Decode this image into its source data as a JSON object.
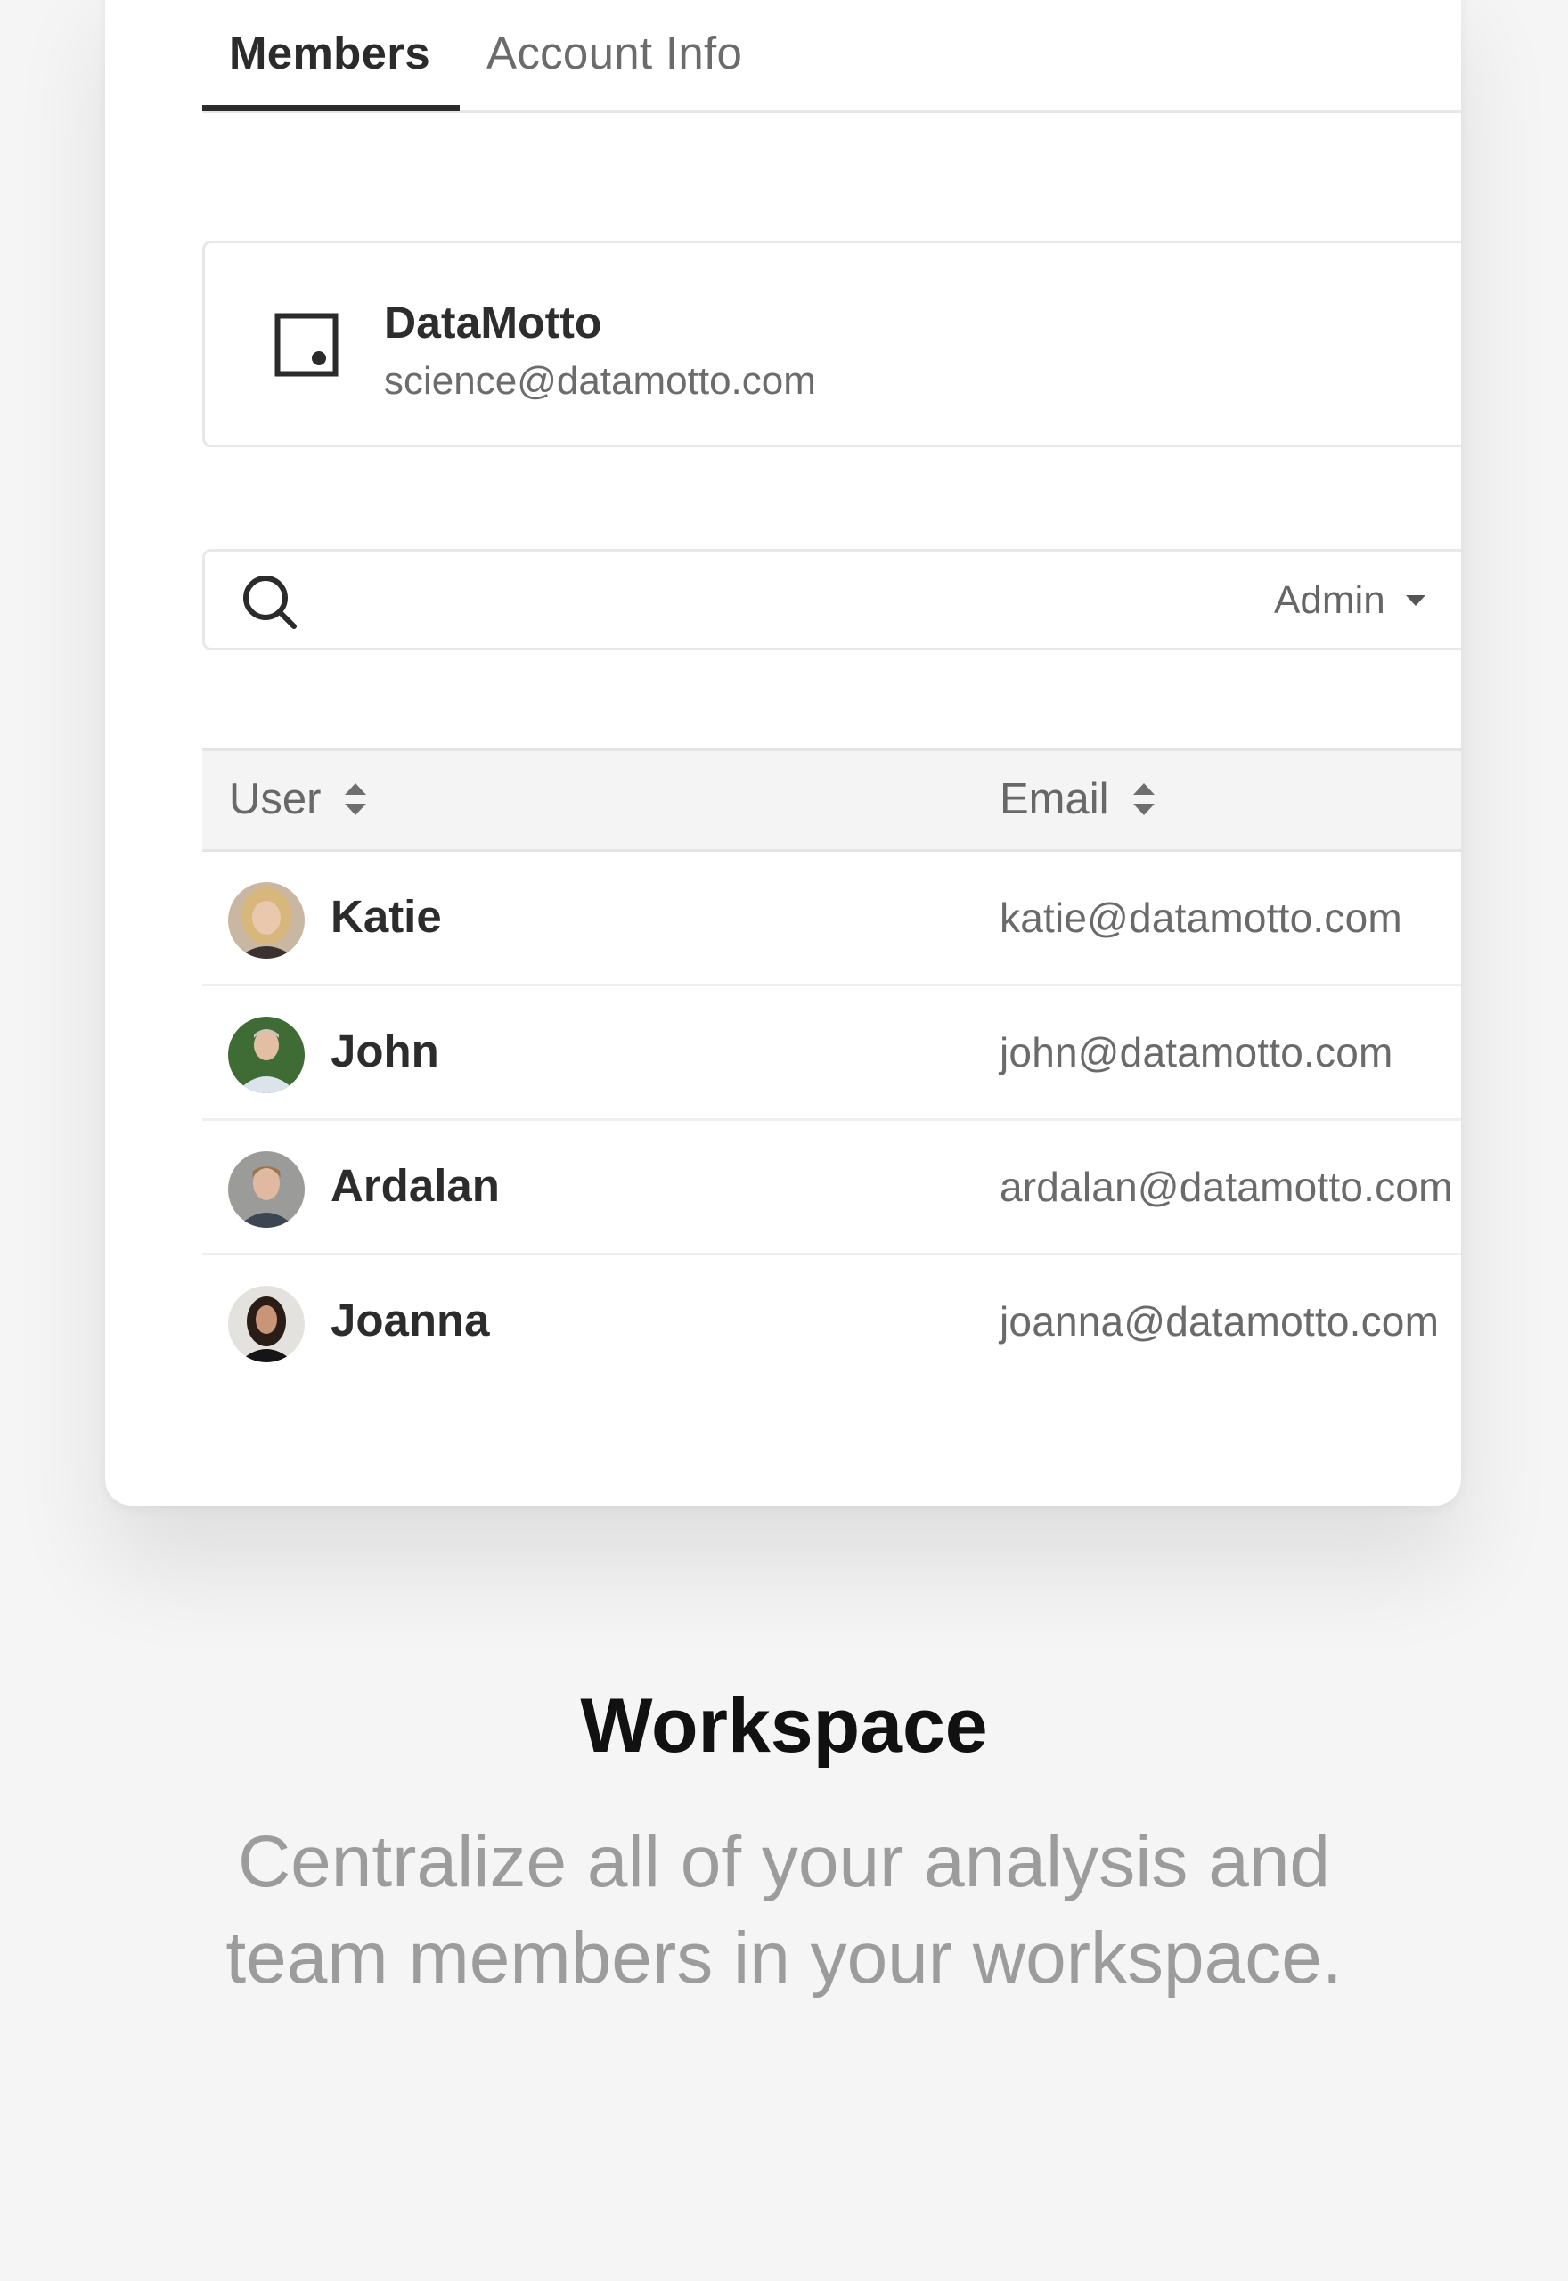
{
  "tabs": [
    {
      "label": "Members",
      "active": true
    },
    {
      "label": "Account Info",
      "active": false
    }
  ],
  "workspace": {
    "name": "DataMotto",
    "email": "science@datamotto.com",
    "icon": "workspace-square-icon"
  },
  "search": {
    "icon": "search-icon",
    "value": "",
    "role_filter": "Admin"
  },
  "table": {
    "columns": [
      "User",
      "Email"
    ],
    "rows": [
      {
        "name": "Katie",
        "email": "katie@datamotto.com"
      },
      {
        "name": "John",
        "email": "john@datamotto.com"
      },
      {
        "name": "Ardalan",
        "email": "ardalan@datamotto.com"
      },
      {
        "name": "Joanna",
        "email": "joanna@datamotto.com"
      }
    ]
  },
  "caption": {
    "title": "Workspace",
    "line1": "Centralize all of your analysis and",
    "line2": "team members in your workspace."
  },
  "colors": {
    "background": "#f5f5f5",
    "card": "#ffffff",
    "text_primary": "#2b2b2b",
    "text_muted": "#6b6b6b",
    "caption_muted": "#9c9c9c"
  }
}
